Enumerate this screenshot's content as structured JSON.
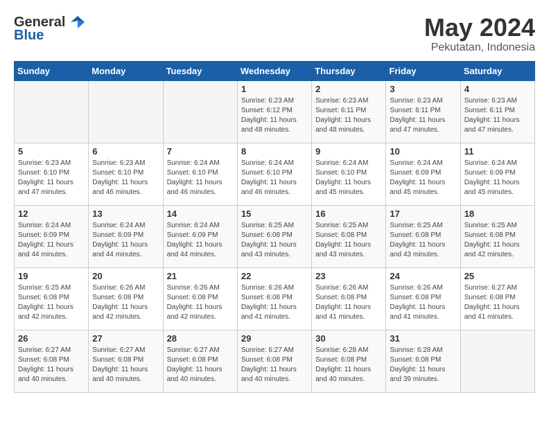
{
  "header": {
    "logo_general": "General",
    "logo_blue": "Blue",
    "month": "May 2024",
    "location": "Pekutatan, Indonesia"
  },
  "weekdays": [
    "Sunday",
    "Monday",
    "Tuesday",
    "Wednesday",
    "Thursday",
    "Friday",
    "Saturday"
  ],
  "weeks": [
    [
      {
        "day": "",
        "info": ""
      },
      {
        "day": "",
        "info": ""
      },
      {
        "day": "",
        "info": ""
      },
      {
        "day": "1",
        "info": "Sunrise: 6:23 AM\nSunset: 6:12 PM\nDaylight: 11 hours\nand 48 minutes."
      },
      {
        "day": "2",
        "info": "Sunrise: 6:23 AM\nSunset: 6:11 PM\nDaylight: 11 hours\nand 48 minutes."
      },
      {
        "day": "3",
        "info": "Sunrise: 6:23 AM\nSunset: 6:11 PM\nDaylight: 11 hours\nand 47 minutes."
      },
      {
        "day": "4",
        "info": "Sunrise: 6:23 AM\nSunset: 6:11 PM\nDaylight: 11 hours\nand 47 minutes."
      }
    ],
    [
      {
        "day": "5",
        "info": "Sunrise: 6:23 AM\nSunset: 6:10 PM\nDaylight: 11 hours\nand 47 minutes."
      },
      {
        "day": "6",
        "info": "Sunrise: 6:23 AM\nSunset: 6:10 PM\nDaylight: 11 hours\nand 46 minutes."
      },
      {
        "day": "7",
        "info": "Sunrise: 6:24 AM\nSunset: 6:10 PM\nDaylight: 11 hours\nand 46 minutes."
      },
      {
        "day": "8",
        "info": "Sunrise: 6:24 AM\nSunset: 6:10 PM\nDaylight: 11 hours\nand 46 minutes."
      },
      {
        "day": "9",
        "info": "Sunrise: 6:24 AM\nSunset: 6:10 PM\nDaylight: 11 hours\nand 45 minutes."
      },
      {
        "day": "10",
        "info": "Sunrise: 6:24 AM\nSunset: 6:09 PM\nDaylight: 11 hours\nand 45 minutes."
      },
      {
        "day": "11",
        "info": "Sunrise: 6:24 AM\nSunset: 6:09 PM\nDaylight: 11 hours\nand 45 minutes."
      }
    ],
    [
      {
        "day": "12",
        "info": "Sunrise: 6:24 AM\nSunset: 6:09 PM\nDaylight: 11 hours\nand 44 minutes."
      },
      {
        "day": "13",
        "info": "Sunrise: 6:24 AM\nSunset: 6:09 PM\nDaylight: 11 hours\nand 44 minutes."
      },
      {
        "day": "14",
        "info": "Sunrise: 6:24 AM\nSunset: 6:09 PM\nDaylight: 11 hours\nand 44 minutes."
      },
      {
        "day": "15",
        "info": "Sunrise: 6:25 AM\nSunset: 6:08 PM\nDaylight: 11 hours\nand 43 minutes."
      },
      {
        "day": "16",
        "info": "Sunrise: 6:25 AM\nSunset: 6:08 PM\nDaylight: 11 hours\nand 43 minutes."
      },
      {
        "day": "17",
        "info": "Sunrise: 6:25 AM\nSunset: 6:08 PM\nDaylight: 11 hours\nand 43 minutes."
      },
      {
        "day": "18",
        "info": "Sunrise: 6:25 AM\nSunset: 6:08 PM\nDaylight: 11 hours\nand 42 minutes."
      }
    ],
    [
      {
        "day": "19",
        "info": "Sunrise: 6:25 AM\nSunset: 6:08 PM\nDaylight: 11 hours\nand 42 minutes."
      },
      {
        "day": "20",
        "info": "Sunrise: 6:26 AM\nSunset: 6:08 PM\nDaylight: 11 hours\nand 42 minutes."
      },
      {
        "day": "21",
        "info": "Sunrise: 6:26 AM\nSunset: 6:08 PM\nDaylight: 11 hours\nand 42 minutes."
      },
      {
        "day": "22",
        "info": "Sunrise: 6:26 AM\nSunset: 6:08 PM\nDaylight: 11 hours\nand 41 minutes."
      },
      {
        "day": "23",
        "info": "Sunrise: 6:26 AM\nSunset: 6:08 PM\nDaylight: 11 hours\nand 41 minutes."
      },
      {
        "day": "24",
        "info": "Sunrise: 6:26 AM\nSunset: 6:08 PM\nDaylight: 11 hours\nand 41 minutes."
      },
      {
        "day": "25",
        "info": "Sunrise: 6:27 AM\nSunset: 6:08 PM\nDaylight: 11 hours\nand 41 minutes."
      }
    ],
    [
      {
        "day": "26",
        "info": "Sunrise: 6:27 AM\nSunset: 6:08 PM\nDaylight: 11 hours\nand 40 minutes."
      },
      {
        "day": "27",
        "info": "Sunrise: 6:27 AM\nSunset: 6:08 PM\nDaylight: 11 hours\nand 40 minutes."
      },
      {
        "day": "28",
        "info": "Sunrise: 6:27 AM\nSunset: 6:08 PM\nDaylight: 11 hours\nand 40 minutes."
      },
      {
        "day": "29",
        "info": "Sunrise: 6:27 AM\nSunset: 6:08 PM\nDaylight: 11 hours\nand 40 minutes."
      },
      {
        "day": "30",
        "info": "Sunrise: 6:28 AM\nSunset: 6:08 PM\nDaylight: 11 hours\nand 40 minutes."
      },
      {
        "day": "31",
        "info": "Sunrise: 6:28 AM\nSunset: 6:08 PM\nDaylight: 11 hours\nand 39 minutes."
      },
      {
        "day": "",
        "info": ""
      }
    ]
  ]
}
